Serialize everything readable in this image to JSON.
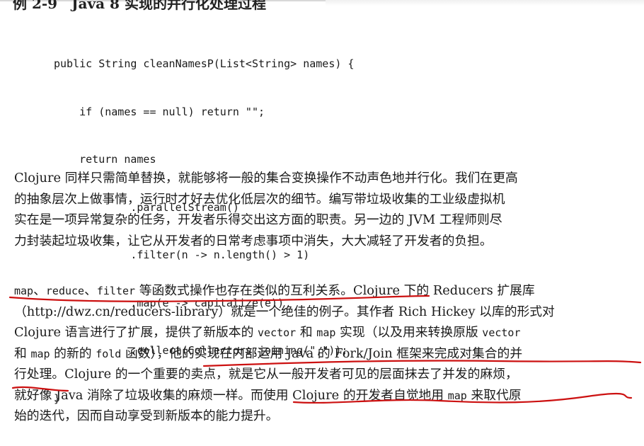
{
  "caption": "例 2-9　Java 8 实现的并行化处理过程",
  "code": [
    "public String cleanNamesP(List<String> names) {",
    "    if (names == null) return \"\";",
    "    return names",
    "            .parallelStream()",
    "            .filter(n -> n.length() > 1)",
    "            .map(e -> capitalize(e))",
    "            .collect(Collectors.joining(\",\"));",
    "}"
  ],
  "paragraph1": [
    "Clojure 同样只需简单替换，就能够将一般的集合变换操作不动声色地并行化。我们在更高",
    "的抽象层次上做事情，运行时才好去优化低层次的细节。编写带垃圾收集的工业级虚拟机",
    "实在是一项异常复杂的任务，开发者乐得交出这方面的职责。另一边的 JVM 工程师则尽",
    "力封装起垃圾收集，让它从开发者的日常考虑事项中消失，大大减轻了开发者的负担。"
  ],
  "paragraph2": {
    "line1": {
      "code_map": "map",
      "sep1": "、",
      "code_reduce": "reduce",
      "sep2": "、",
      "code_filter": "filter",
      "rest": " 等函数式操作也存在类似的互利关系。Clojure 下的 Reducers 扩展库"
    },
    "line2": "（http://dwz.cn/reducers-library）就是一个绝佳的例子。其作者 Rich Hickey 以库的形式对",
    "line3": {
      "a": "Clojure 语言进行了扩展，提供了新版本的 ",
      "code_vector": "vector",
      "b": " 和 ",
      "code_map": "map",
      "c": " 实现（以及用来转换原版 ",
      "code_vector2": "vector"
    },
    "line4": {
      "a": "和 ",
      "code_map": "map",
      "b": " 的新的 ",
      "code_fold": "fold",
      "c": " 函数），他的实现在内部运用 Java 的 Fork/Join 框架来完成对集合的并"
    },
    "line5": "行处理。Clojure 的一个重要的卖点，就是它从一般开发者可见的层面抹去了并发的麻烦，",
    "line6": {
      "a": "就好像 Java 消除了垃圾收集的麻烦一样。而使用 Clojure 的开发者自觉地用 ",
      "code_map": "map",
      "b": " 来取代原"
    },
    "line7": "始的迭代，因而自动享受到新版本的能力提升。"
  },
  "annotation_color": "#cc1111"
}
